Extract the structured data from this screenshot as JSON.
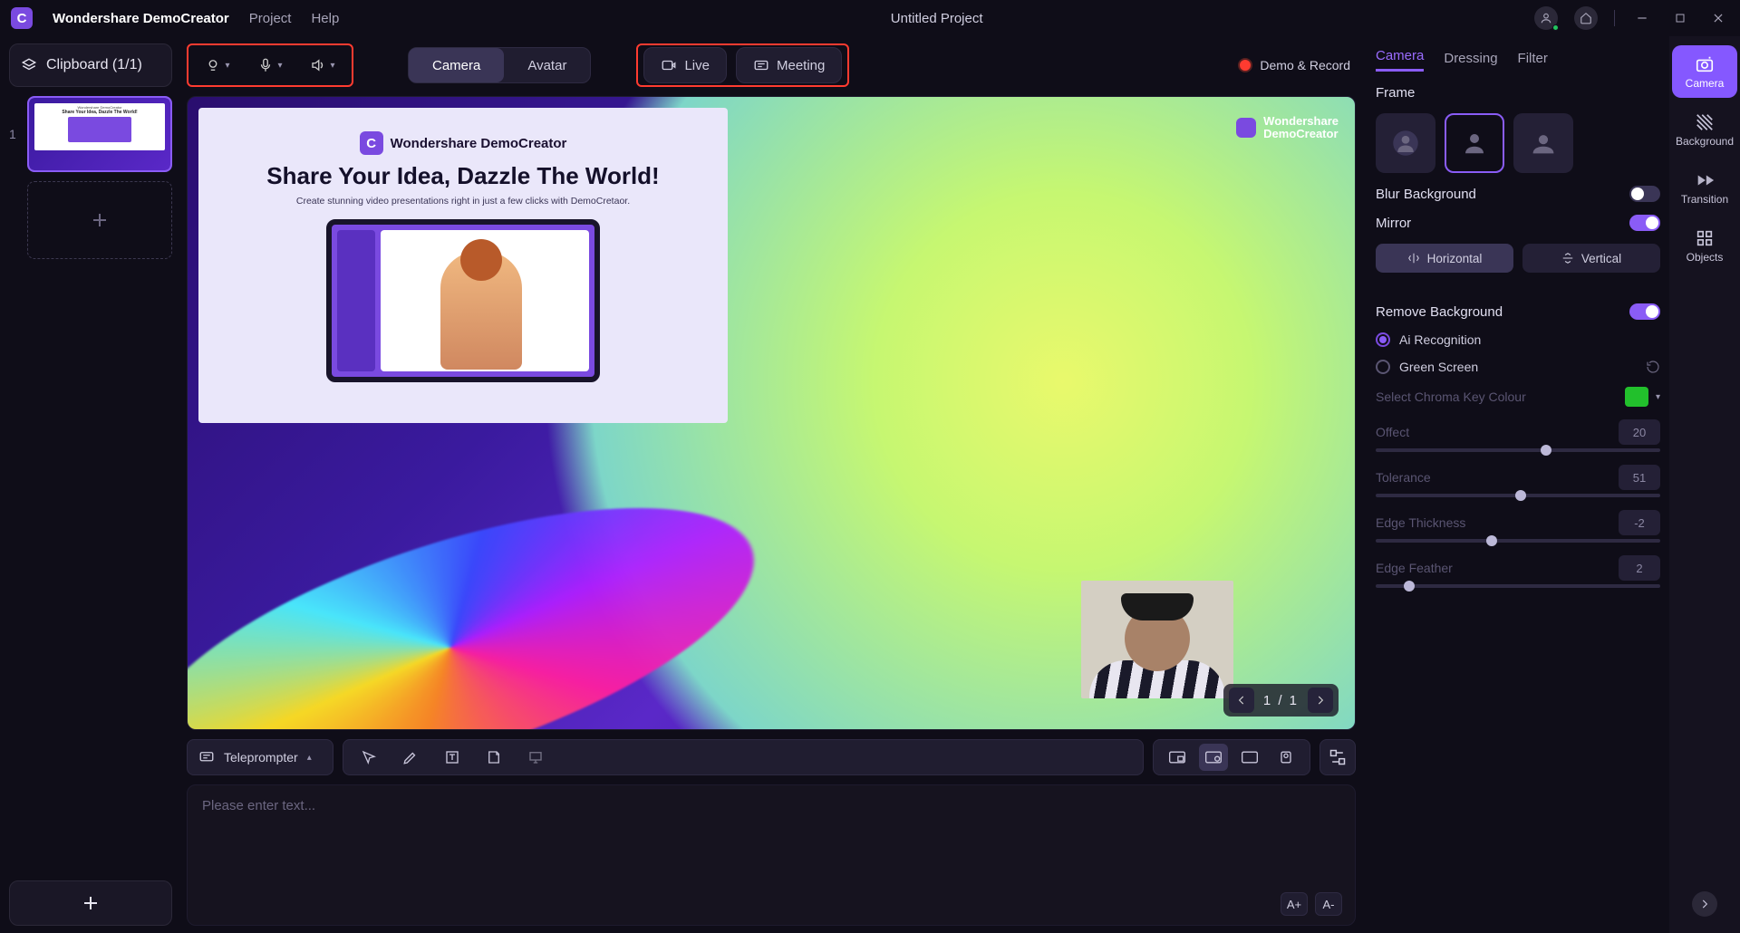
{
  "app": {
    "name": "Wondershare DemoCreator",
    "logo_letter": "C"
  },
  "menu": {
    "project": "Project",
    "help": "Help"
  },
  "title": "Untitled Project",
  "clipboard": {
    "label": "Clipboard (1/1)",
    "clip_index": "1"
  },
  "toolbar": {
    "camera": "Camera",
    "avatar": "Avatar",
    "live": "Live",
    "meeting": "Meeting",
    "demo_record": "Demo & Record"
  },
  "slide": {
    "brand": "Wondershare DemoCreator",
    "headline": "Share Your Idea, Dazzle The World!",
    "subline": "Create stunning video presentations right in just a few clicks with DemoCretaor."
  },
  "overlay_brand": {
    "line1": "Wondershare",
    "line2": "DemoCreator"
  },
  "pager": {
    "label": "1 / 1"
  },
  "teleprompter": {
    "btn": "Teleprompter",
    "placeholder": "Please enter text...",
    "inc": "A+",
    "dec": "A-"
  },
  "right": {
    "tabs": {
      "camera": "Camera",
      "dressing": "Dressing",
      "filter": "Filter"
    },
    "frame": "Frame",
    "blur_bg": "Blur Background",
    "mirror": "Mirror",
    "horizontal": "Horizontal",
    "vertical": "Vertical",
    "remove_bg": "Remove Background",
    "ai_rec": "Ai Recognition",
    "green_screen": "Green Screen",
    "chroma": "Select Chroma Key Colour",
    "sliders": {
      "offect": {
        "label": "Offect",
        "value": "20",
        "pos": 58
      },
      "tolerance": {
        "label": "Tolerance",
        "value": "51",
        "pos": 49
      },
      "edge_thickness": {
        "label": "Edge Thickness",
        "value": "-2",
        "pos": 39
      },
      "edge_feather": {
        "label": "Edge Feather",
        "value": "2",
        "pos": 10
      }
    }
  },
  "rail": {
    "camera": "Camera",
    "background": "Background",
    "transition": "Transition",
    "objects": "Objects"
  }
}
